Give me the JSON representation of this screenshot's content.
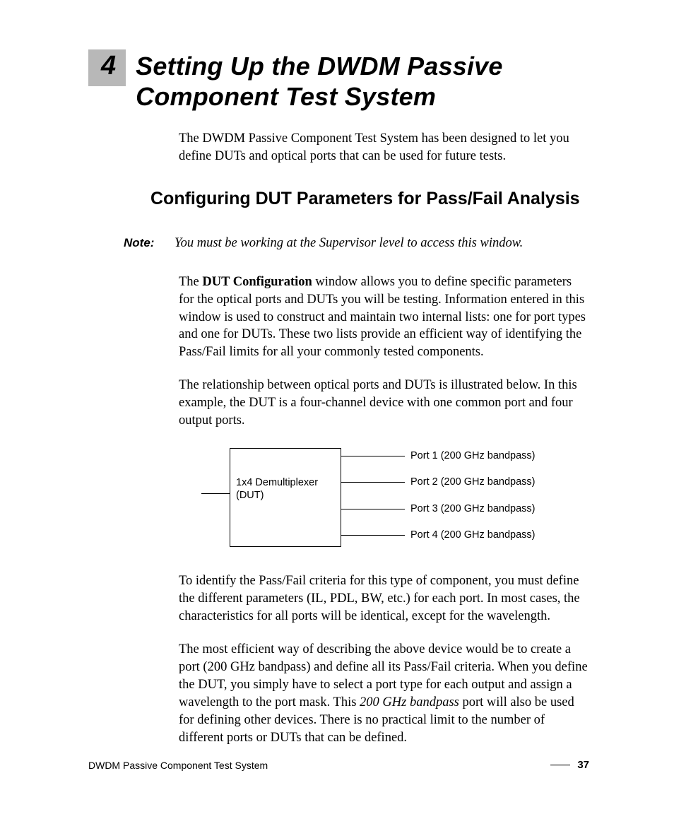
{
  "chapter": {
    "number": "4",
    "title": "Setting Up the DWDM Passive Component Test System"
  },
  "intro": "The DWDM Passive Component Test System has been designed to let you define DUTs and optical ports that can be used for future tests.",
  "section_heading": "Configuring DUT Parameters for Pass/Fail Analysis",
  "note": {
    "label": "Note:",
    "text": "You must be working at the Supervisor level to access this window."
  },
  "para1_a": "The ",
  "para1_b_bold": "DUT Configuration",
  "para1_c": " window allows you to define specific parameters for the optical ports and DUTs you will be testing. Information entered in this window is used to construct and maintain two internal lists: one for port types and one for DUTs. These two lists provide an efficient way of identifying the Pass/Fail limits for all your commonly tested components.",
  "para2": "The relationship between optical ports and DUTs is illustrated below. In this example, the DUT is a four-channel device with one common port and four output ports.",
  "diagram": {
    "dut_line1": "1x4 Demultiplexer",
    "dut_line2": "(DUT)",
    "ports": [
      "Port 1 (200 GHz bandpass)",
      "Port 2 (200 GHz bandpass)",
      "Port 3 (200 GHz bandpass)",
      "Port 4 (200 GHz bandpass)"
    ]
  },
  "para3": "To identify the Pass/Fail criteria for this type of component, you must define the different parameters (IL, PDL, BW, etc.) for each port. In most cases, the characteristics for all ports will be identical, except for the wavelength.",
  "para4_a": "The most efficient way of describing the above device would be to create a port (200 GHz bandpass) and define all its Pass/Fail criteria. When you define the DUT, you simply have to select a port type for each output and assign a wavelength to the port mask. This ",
  "para4_b_ital": "200 GHz bandpass",
  "para4_c": " port will also be used for defining other devices. There is no practical limit to the number of different ports or DUTs that can be defined.",
  "footer": {
    "doc_title": "DWDM Passive Component Test System",
    "page": "37"
  }
}
